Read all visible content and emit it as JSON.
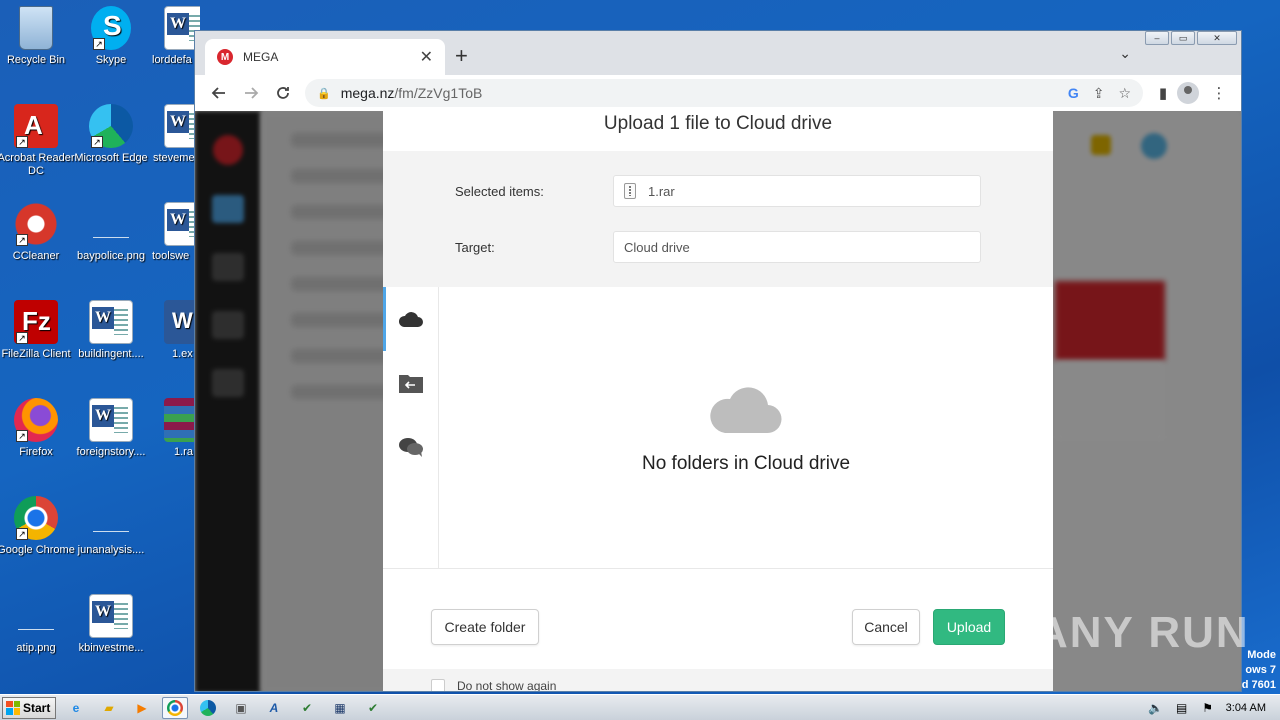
{
  "desktop": {
    "icons": [
      {
        "label": "Recycle Bin",
        "icon": "recycle-bin-icon"
      },
      {
        "label": "Skype",
        "icon": "skype-icon"
      },
      {
        "label": "lorddefa",
        "icon": "word-doc-icon"
      },
      {
        "label": "Acrobat Reader DC",
        "icon": "acrobat-icon"
      },
      {
        "label": "Microsoft Edge",
        "icon": "edge-icon"
      },
      {
        "label": "steveme",
        "icon": "word-doc-icon"
      },
      {
        "label": "CCleaner",
        "icon": "ccleaner-icon"
      },
      {
        "label": "baypolice.png",
        "icon": "image-file-icon"
      },
      {
        "label": "toolswe",
        "icon": "word-doc-icon"
      },
      {
        "label": "FileZilla Client",
        "icon": "filezilla-icon"
      },
      {
        "label": "buildingent....",
        "icon": "word-doc-icon"
      },
      {
        "label": "1.ex",
        "icon": "word-app-icon"
      },
      {
        "label": "Firefox",
        "icon": "firefox-icon"
      },
      {
        "label": "foreignstory....",
        "icon": "word-doc-icon"
      },
      {
        "label": "1.ra",
        "icon": "winrar-icon"
      },
      {
        "label": "Google Chrome",
        "icon": "chrome-icon"
      },
      {
        "label": "junanalysis....",
        "icon": "image-file-icon"
      },
      {
        "label": "atip.png",
        "icon": "image-file-icon"
      },
      {
        "label": "kbinvestme...",
        "icon": "word-doc-icon"
      }
    ]
  },
  "browser": {
    "tab_title": "MEGA",
    "tab_close": "✕",
    "new_tab": "+",
    "url_host": "mega.nz",
    "url_path": "/fm/ZzVg1ToB"
  },
  "dialog": {
    "title": "Upload 1 file to Cloud drive",
    "selected_items_label": "Selected items:",
    "selected_items_value": "1.rar",
    "target_label": "Target:",
    "target_value": "Cloud drive",
    "empty_message": "No folders in Cloud drive",
    "create_folder_button": "Create folder",
    "cancel_button": "Cancel",
    "upload_button": "Upload",
    "dont_show_again": "Do not show again",
    "colors": {
      "primary": "#31b981",
      "active_tab_indicator": "#4fa6e8"
    }
  },
  "taskbar": {
    "start_label": "Start",
    "clock": "3:04 AM"
  },
  "watermark": "ANY RUN",
  "os_text": [
    "Mode",
    "ows 7",
    "d 7601"
  ]
}
